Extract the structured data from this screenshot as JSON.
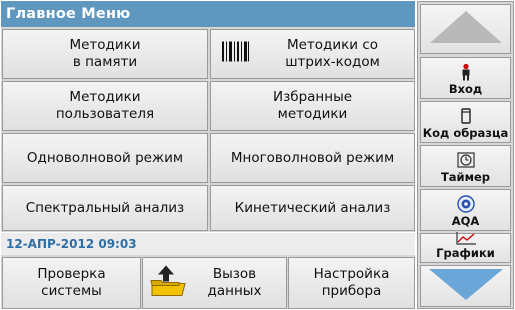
{
  "title": "Главное Меню",
  "menu": {
    "saved_methods": "Методики\nв памяти",
    "barcode_methods": "Методики со\nштрих-кодом",
    "user_methods": "Методики\nпользователя",
    "favorite_methods": "Избранные\nметодики",
    "single_wavelength": "Одноволновой режим",
    "multi_wavelength": "Многоволновой режим",
    "spectral_scan": "Спектральный анализ",
    "kinetic": "Кинетический анализ"
  },
  "status": {
    "datetime": "12-АПР-2012  09:03"
  },
  "bottom": {
    "system_check": "Проверка\nсистемы",
    "recall_data": "Вызов\nданных",
    "instrument_setup": "Настройка\nприбора"
  },
  "sidebar": {
    "login": "Вход",
    "sample_id": "Код образца",
    "timer": "Таймер",
    "aqa": "AQA",
    "graphs": "Графики"
  },
  "icons": {
    "scroll_up": "triangle-up-icon",
    "login": "person-icon",
    "sample_id": "vial-icon",
    "timer": "timer-icon",
    "aqa": "aqa-icon",
    "graphs": "graph-icon",
    "scroll_down": "triangle-down-icon",
    "barcode": "barcode-icon",
    "recall": "folder-arrow-icon"
  },
  "colors": {
    "title_bar": "#5f97bf",
    "status_text": "#2f6fa8",
    "arrow_fill": "#6aa6d8"
  }
}
